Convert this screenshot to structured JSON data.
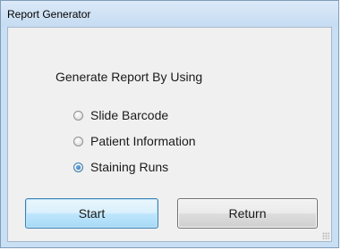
{
  "window": {
    "title": "Report Generator"
  },
  "form": {
    "heading": "Generate Report By Using",
    "options": [
      {
        "label": "Slide Barcode",
        "checked": false
      },
      {
        "label": "Patient Information",
        "checked": false
      },
      {
        "label": "Staining Runs",
        "checked": true
      }
    ]
  },
  "buttons": {
    "start_label": "Start",
    "return_label": "Return"
  }
}
